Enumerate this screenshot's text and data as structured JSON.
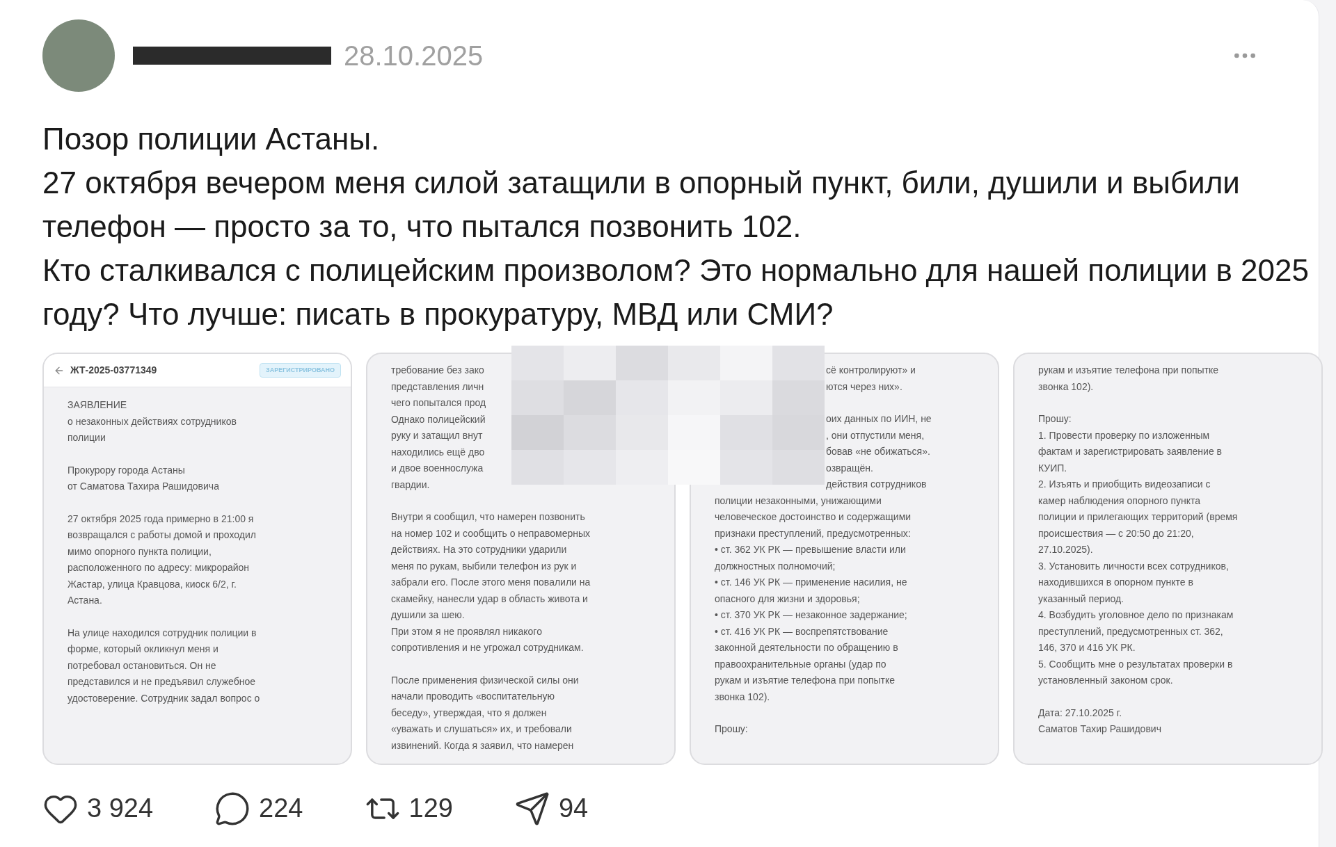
{
  "post": {
    "date": "28.10.2025",
    "text": [
      "Позор полиции Астаны.",
      "27 октября вечером меня силой затащили в опорный пункт, били, душили и выбили телефон — просто за то, что пытался позвонить 102.",
      "Кто сталкивался с полицейским произволом? Это нормально для нашей полиции в 2025 году? Что лучше: писать в прокуратуру, МВД или СМИ?"
    ],
    "attachments": [
      {
        "header": {
          "ticket": "ЖТ-2025-03771349",
          "status": "ЗАРЕГИСТРИРОВАНО"
        },
        "paragraphs": [
          {
            "lines": [
              "ЗАЯВЛЕНИЕ",
              "о незаконных действиях сотрудников",
              "полиции"
            ]
          },
          {
            "lines": [
              "Прокурору города Астаны",
              "от Саматова Тахира Рашидовича"
            ]
          },
          {
            "lines": [
              "27 октября 2025 года примерно в 21:00 я",
              "возвращался с работы домой и проходил",
              "мимо опорного пункта полиции,",
              "расположенного по адресу: микрорайон",
              "Жастар, улица Кравцова, киоск 6/2, г.",
              "Астана."
            ]
          },
          {
            "lines": [
              "На улице находился сотрудник полиции в",
              "форме, который окликнул меня и",
              "потребовал остановиться. Он не",
              "представился и не предъявил служебное",
              "удостоверение. Сотрудник задал вопрос о"
            ]
          }
        ]
      },
      {
        "paragraphs": [
          {
            "lines": [
              "требование без зако",
              "представления личн",
              "чего попытался прод",
              "Однако полицейский",
              "руку и затащил внут",
              "находились ещё дво",
              "и двое военнослужа",
              "гвардии."
            ]
          },
          {
            "lines": [
              "Внутри я сообщил, что намерен позвонить",
              "на номер 102 и сообщить о неправомерных",
              "действиях. На это сотрудники ударили",
              "меня по рукам, выбили телефон из рук и",
              "забрали его. После этого меня повалили на",
              "скамейку, нанесли удар в область живота и",
              "душили за шею.",
              "При этом я не проявлял никакого",
              "сопротивления и не угрожал сотрудникам."
            ]
          },
          {
            "lines": [
              "После применения физической силы они",
              "начали проводить «воспитательную",
              "беседу», утверждая, что я должен",
              "«уважать и слушаться» их, и требовали",
              "извинений. Когда я заявил, что намерен"
            ]
          }
        ]
      },
      {
        "paragraphs": [
          {
            "partial": true,
            "lines": [
              "сё контролируют» и",
              "ются через них»."
            ]
          },
          {
            "partial": true,
            "continues": true,
            "lines": [
              "оих данных по ИИН, не",
              ", они отпустили меня,",
              "бовав «не обижаться».",
              "озвращён."
            ]
          },
          {
            "partial": true,
            "continues": true,
            "lines": [
              "действия сотрудников"
            ]
          },
          {
            "lines": [
              "полиции незаконными, унижающими",
              "человеческое достоинство и содержащими",
              "признаки преступлений, предусмотренных:",
              "• ст. 362 УК РК — превышение власти или",
              "должностных полномочий;",
              "• ст. 146 УК РК — применение насилия, не",
              "опасного для жизни и здоровья;",
              "• ст. 370 УК РК — незаконное задержание;",
              "• ст. 416 УК РК — воспрепятствование",
              "законной деятельности по обращению в",
              "правоохранительные органы (удар по",
              "рукам и изъятие телефона при попытке",
              "звонка 102)."
            ]
          },
          {
            "lines": [
              "Прошу:"
            ]
          }
        ]
      },
      {
        "paragraphs": [
          {
            "lines": [
              "рукам и изъятие телефона при попытке",
              "звонка 102)."
            ]
          },
          {
            "lines": [
              "Прошу:",
              "1. Провести проверку по изложенным",
              "фактам и зарегистрировать заявление в",
              "КУИП.",
              "2. Изъять и приобщить видеозаписи с",
              "камер наблюдения опорного пункта",
              "полиции и прилегающих территорий (время",
              "происшествия — с 20:50 до 21:20,",
              "27.10.2025).",
              "3. Установить личности всех сотрудников,",
              "находившихся в опорном пункте в",
              "указанный период.",
              "4. Возбудить уголовное дело по признакам",
              "преступлений, предусмотренных ст. 362,",
              "146, 370 и 416 УК РК.",
              "5. Сообщить мне о результатах проверки в",
              "установленный законом срок."
            ]
          },
          {
            "lines": [
              "Дата: 27.10.2025 г.",
              "Саматов Тахир Рашидович"
            ]
          }
        ]
      }
    ],
    "actions": [
      {
        "kind": "like",
        "count": "3 924"
      },
      {
        "kind": "comment",
        "count": "224"
      },
      {
        "kind": "repost",
        "count": "129"
      },
      {
        "kind": "share",
        "count": "94"
      }
    ]
  }
}
